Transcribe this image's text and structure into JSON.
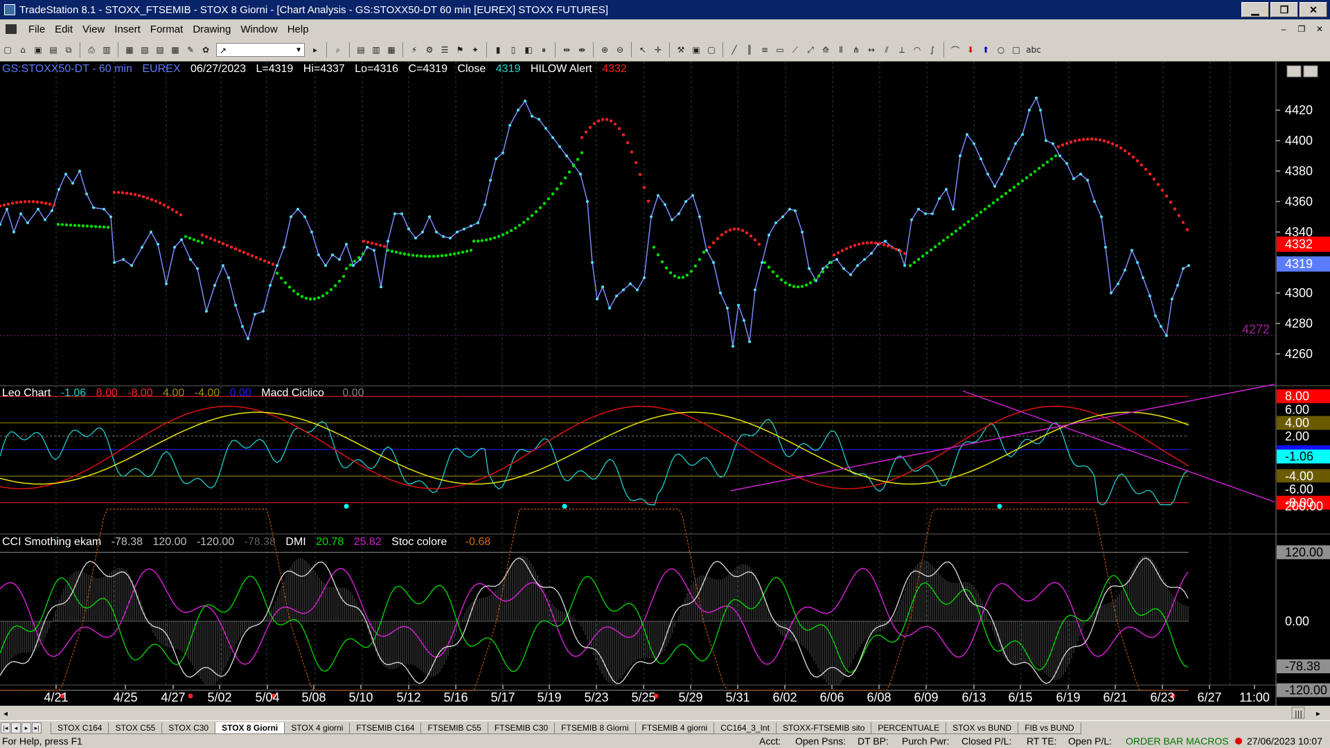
{
  "window": {
    "title": "TradeStation 8.1 - STOXX_FTSEMIB - STOX  8 Giorni - [Chart Analysis - GS:STOXX50-DT  60 min  [EUREX] STOXX FUTURES]",
    "min": "▁",
    "max": "❐",
    "close": "✕"
  },
  "menu": [
    "File",
    "Edit",
    "View",
    "Insert",
    "Format",
    "Drawing",
    "Window",
    "Help"
  ],
  "mdi_buttons": [
    "–",
    "❐",
    "✕"
  ],
  "toolbar": {
    "combo_value": "↗"
  },
  "price_header": {
    "symbol": "GS:STOXX50-DT - 60 min",
    "exchange": "EUREX",
    "date": "06/27/2023",
    "last": "L=4319",
    "high": "Hi=4337",
    "low": "Lo=4316",
    "close_val": "C=4319",
    "close_label": "Close",
    "close_num": "4319",
    "alert_label": "HILOW Alert",
    "alert_val": "4332"
  },
  "macd_header": {
    "name": "Leo Chart",
    "v1": "-1.06",
    "v2": "8.00",
    "v3": "-8.00",
    "v4": "4.00",
    "v5": "-4.00",
    "v6": "0.00",
    "name2": "Macd Ciclico",
    "v7": "0.00"
  },
  "cci_header": {
    "name": "CCI Smothing ekam",
    "v1": "-78.38",
    "v2": "120.00",
    "v3": "-120.00",
    "v4": "-78.38",
    "dmi": "DMI",
    "d1": "20.78",
    "d2": "25.82",
    "stoc": "Stoc colore",
    "s1": "-0.68"
  },
  "price_axis": {
    "ticks": [
      "4420",
      "4400",
      "4380",
      "4360",
      "4340",
      "4300",
      "4280",
      "4260"
    ],
    "badge_red": "4332",
    "badge_blue": "4319",
    "level_label": "4272"
  },
  "macd_axis": {
    "ticks": [
      "6.00",
      "2.00"
    ],
    "badge_8": "8.00",
    "badge_4": "4.00",
    "badge_m106": "-1.06",
    "badge_m4": "-4.00",
    "badge_m6": "-6.00",
    "badge_m8": "-8.00"
  },
  "cci_axis": {
    "ticks": [
      "200.00",
      "0.00"
    ],
    "badge_120": "120.00",
    "badge_m78": "-78.38",
    "badge_m120": "-120.00"
  },
  "date_axis": [
    "4/21",
    "4/25",
    "4/27",
    "5/02",
    "5/04",
    "5/08",
    "5/10",
    "5/12",
    "5/16",
    "5/17",
    "5/19",
    "5/23",
    "5/25",
    "5/29",
    "5/31",
    "6/02",
    "6/06",
    "6/08",
    "6/09",
    "6/13",
    "6/15",
    "6/19",
    "6/21",
    "6/23",
    "6/27",
    "11:00"
  ],
  "tabs": [
    "STOX C164",
    "STOX C55",
    "STOX  C30",
    "STOX  8 Giorni",
    "STOX 4 giorni",
    "FTSEMIB C164",
    "FTSEMIB C55",
    "FTSEMIB C30",
    "FTSEMIB  8 Giorni",
    "FTSEMIB  4 giorni",
    "CC164_3_Int",
    "STOXX-FTSEMIB sito",
    "PERCENTUALE",
    "STOX vs BUND",
    "FIB vs BUND"
  ],
  "active_tab": "STOX  8 Giorni",
  "status": {
    "help": "For Help, press F1",
    "acct": "Acct:",
    "open_psns": "Open Psns:",
    "dt_bp": "DT BP:",
    "purch_pwr": "Purch Pwr:",
    "closed_pl": "Closed P/L:",
    "rt_te": "RT TE:",
    "open_pl": "Open P/L:",
    "macros": "ORDER BAR  MACROS",
    "datetime": "27/06/2023 10:07"
  },
  "colors": {
    "bg": "#000000",
    "price": "#7b8cff",
    "dots": "#55e0ff",
    "green": "#00e000",
    "red": "#ff2020",
    "cyan": "#20d0d0",
    "yellow": "#e8e800",
    "magenta": "#d020d0",
    "label_blue": "#5c7cff"
  }
}
